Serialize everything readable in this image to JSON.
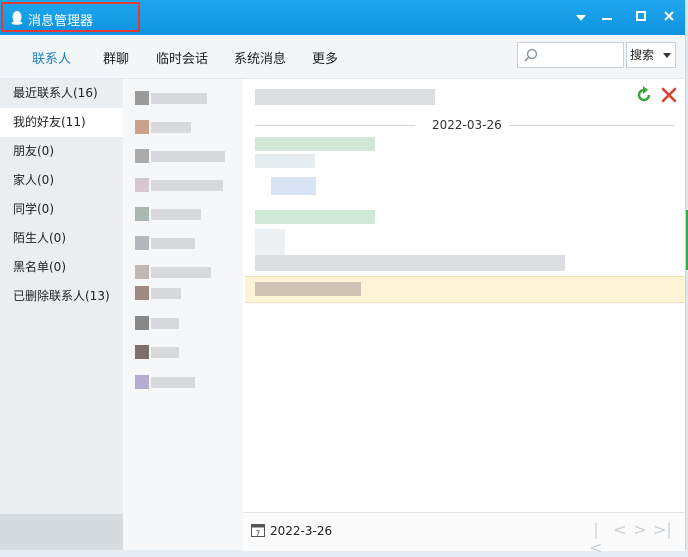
{
  "window": {
    "title": "消息管理器"
  },
  "nav": {
    "tabs": [
      {
        "label": "联系人"
      },
      {
        "label": "群聊"
      },
      {
        "label": "临时会话"
      },
      {
        "label": "系统消息"
      },
      {
        "label": "更多"
      }
    ],
    "active_index": 0
  },
  "search": {
    "placeholder": "",
    "button_label": "搜索"
  },
  "sidebar": {
    "items": [
      {
        "label": "最近联系人(16)"
      },
      {
        "label": "我的好友(11)"
      },
      {
        "label": "朋友(0)"
      },
      {
        "label": "家人(0)"
      },
      {
        "label": "同学(0)"
      },
      {
        "label": "陌生人(0)"
      },
      {
        "label": "黑名单(0)"
      },
      {
        "label": "已删除联系人(13)"
      }
    ],
    "selected_index": 1
  },
  "chat": {
    "date_header": "2022-03-26",
    "footer_date": "2022-3-26"
  },
  "colors": {
    "titlebar": "#1299e3",
    "accent": "#1b7fc4",
    "highlight_row": "#fdf3d7",
    "title_highlight_border": "#e53935"
  },
  "icons": [
    "qq-penguin-icon",
    "minimize-icon",
    "maximize-icon",
    "close-icon",
    "dropdown-icon",
    "search-icon",
    "refresh-icon",
    "delete-icon",
    "calendar-icon",
    "first-page-icon",
    "prev-page-icon",
    "next-page-icon",
    "last-page-icon"
  ]
}
